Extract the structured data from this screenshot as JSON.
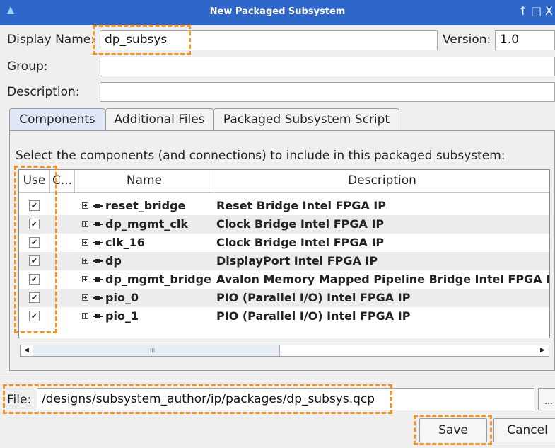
{
  "window": {
    "title": "New Packaged Subsystem",
    "controls": [
      "↑",
      "□",
      "X"
    ]
  },
  "form": {
    "display_name_label": "Display Name:",
    "display_name_value": "dp_subsys",
    "version_label": "Version:",
    "version_value": "1.0",
    "group_label": "Group:",
    "group_value": "",
    "description_label": "Description:",
    "description_value": ""
  },
  "tabs": [
    {
      "label": "Components",
      "active": true
    },
    {
      "label": "Additional Files",
      "active": false
    },
    {
      "label": "Packaged Subsystem Script",
      "active": false
    }
  ],
  "instructions": "Select the components (and connections) to include in this packaged subsystem:",
  "table": {
    "columns": [
      "Use",
      "C...",
      "Name",
      "Description"
    ],
    "rows": [
      {
        "use": true,
        "name": "reset_bridge",
        "description": "Reset Bridge Intel FPGA IP"
      },
      {
        "use": true,
        "name": "dp_mgmt_clk",
        "description": "Clock Bridge Intel FPGA IP"
      },
      {
        "use": true,
        "name": "clk_16",
        "description": "Clock Bridge Intel FPGA IP"
      },
      {
        "use": true,
        "name": "dp",
        "description": "DisplayPort Intel FPGA IP"
      },
      {
        "use": true,
        "name": "dp_mgmt_bridge",
        "description": "Avalon Memory Mapped Pipeline Bridge Intel FPGA IP"
      },
      {
        "use": true,
        "name": "pio_0",
        "description": "PIO (Parallel I/O) Intel FPGA IP"
      },
      {
        "use": true,
        "name": "pio_1",
        "description": "PIO (Parallel I/O) Intel FPGA IP"
      }
    ],
    "checkmark": "✔"
  },
  "scrollbar": {
    "left_arrow": "◀",
    "right_arrow": "▶",
    "grip": "III"
  },
  "file": {
    "label": "File:",
    "path": "/designs/subsystem_author/ip/packages/dp_subsys.qcp",
    "browse_label": "..."
  },
  "buttons": {
    "save": "Save",
    "cancel": "Cancel"
  },
  "colors": {
    "titlebar": "#2f66c9",
    "highlight": "#f0932b",
    "active_tab": "#dfe8f6"
  }
}
